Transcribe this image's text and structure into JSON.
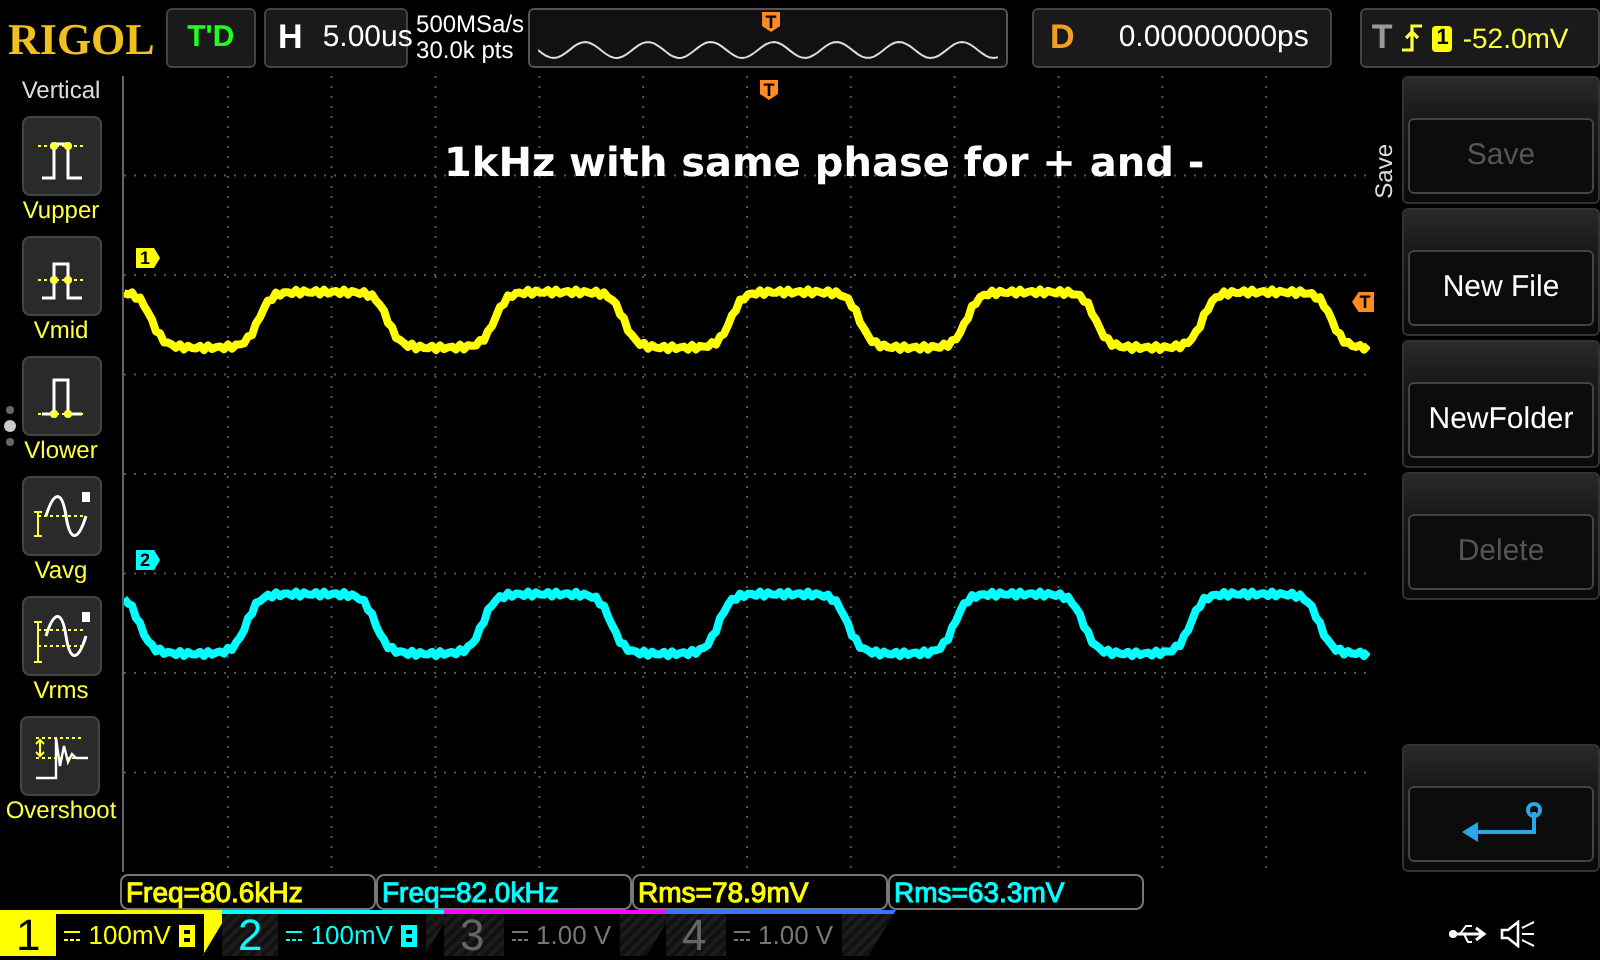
{
  "header": {
    "logo": "RIGOL",
    "run_status": "T'D",
    "timebase_label": "H",
    "timebase": "5.00us",
    "sample_rate": "500MSa/s",
    "memory_depth": "30.0k pts",
    "overview_trigger_marker": "T",
    "delay_label": "D",
    "delay": "0.00000000ps",
    "trigger_label": "T",
    "trigger_source": "1",
    "trigger_level": "-52.0mV"
  },
  "measure_menu": {
    "title": "Vertical",
    "items": [
      {
        "label": "Vupper",
        "kind": "vupper"
      },
      {
        "label": "Vmid",
        "kind": "vmid"
      },
      {
        "label": "Vlower",
        "kind": "vlower"
      },
      {
        "label": "Vavg",
        "kind": "vavg"
      },
      {
        "label": "Vrms",
        "kind": "vrms"
      },
      {
        "label": "Overshoot",
        "kind": "overshoot"
      }
    ]
  },
  "plot": {
    "annotation": "1kHz with same phase for + and -",
    "trigger_position_marker": "T",
    "trigger_level_marker": "T",
    "channel_markers": [
      {
        "label": "1",
        "color": "#ffff00"
      },
      {
        "label": "2",
        "color": "#00ffff"
      }
    ]
  },
  "side_menu": {
    "title": "Save",
    "buttons": [
      {
        "kind": "text",
        "label": "Save",
        "disabled": true
      },
      {
        "kind": "text",
        "label": "New File",
        "disabled": false
      },
      {
        "kind": "text",
        "label": "NewFolder",
        "disabled": false
      },
      {
        "kind": "text",
        "label": "Delete",
        "disabled": true
      },
      {
        "kind": "return"
      }
    ]
  },
  "measurements": [
    {
      "text": "Freq=80.6kHz",
      "kind": "ch1"
    },
    {
      "text": "Freq=82.0kHz",
      "kind": "ch2"
    },
    {
      "text": "Rms=78.9mV",
      "kind": "ch1"
    },
    {
      "text": "Rms=63.3mV",
      "kind": "ch2"
    }
  ],
  "channels": [
    {
      "number": "1",
      "scale": "100mV",
      "selected": true,
      "on": true,
      "color": "#ffff00"
    },
    {
      "number": "2",
      "scale": "100mV",
      "selected": false,
      "on": true,
      "color": "#00ffff"
    },
    {
      "number": "3",
      "scale": "1.00 V",
      "selected": false,
      "on": false,
      "color": "#ff00ff"
    },
    {
      "number": "4",
      "scale": "1.00 V",
      "selected": false,
      "on": false,
      "color": "#3377ff"
    }
  ]
}
